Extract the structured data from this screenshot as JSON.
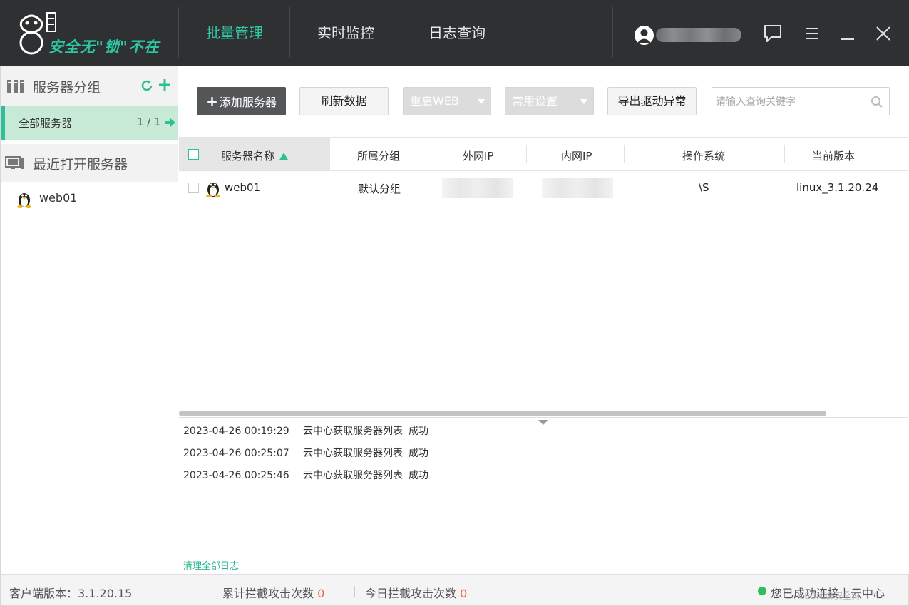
{
  "header": {
    "logo_text": "安全无\"锁\"不在",
    "nav": [
      {
        "label": "批量管理",
        "active": true
      },
      {
        "label": "实时监控",
        "active": false
      },
      {
        "label": "日志查询",
        "active": false
      }
    ],
    "accent_color": "#30c9a6"
  },
  "sidebar": {
    "group_title": "服务器分组",
    "all_servers": {
      "label": "全部服务器",
      "count": "1 / 1"
    },
    "recent_title": "最近打开服务器",
    "servers": [
      {
        "name": "web01",
        "os": "linux"
      }
    ]
  },
  "toolbar": {
    "add_server": "添加服务器",
    "refresh": "刷新数据",
    "restart_web": "重启WEB",
    "common_settings": "常用设置",
    "export_driver": "导出驱动异常",
    "search_placeholder": "请输入查询关键字"
  },
  "table": {
    "columns": [
      "服务器名称",
      "所属分组",
      "外网IP",
      "内网IP",
      "操作系统",
      "当前版本"
    ],
    "sorted_column": "服务器名称",
    "rows": [
      {
        "name": "web01",
        "group": "默认分组",
        "os": "\\S",
        "version": "linux_3.1.20.24"
      }
    ]
  },
  "log": {
    "entries": [
      {
        "time": "2023-04-26 00:19:29",
        "message": "云中心获取服务器列表",
        "status": "成功"
      },
      {
        "time": "2023-04-26 00:25:07",
        "message": "云中心获取服务器列表",
        "status": "成功"
      },
      {
        "time": "2023-04-26 00:25:46",
        "message": "云中心获取服务器列表",
        "status": "成功"
      }
    ],
    "clear_label": "清理全部日志"
  },
  "statusbar": {
    "client_version": "客户端版本：3.1.20.15",
    "total_blocked_label": "累计拦截攻击次数",
    "total_blocked": "0",
    "separator": "|",
    "today_blocked_label": "今日拦截攻击次数",
    "today_blocked": "0",
    "connection": "您已成功连接上云中心",
    "watermark": "CSDN @安全狗"
  }
}
